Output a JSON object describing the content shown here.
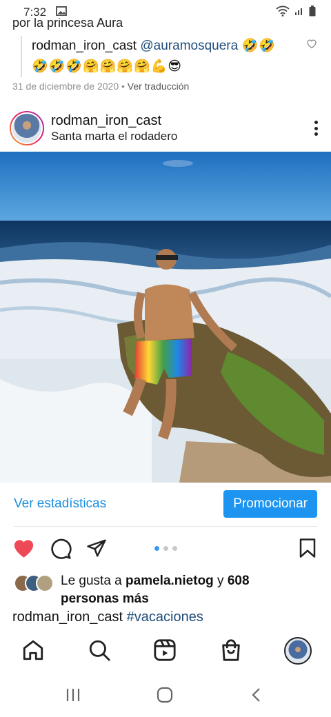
{
  "status_bar": {
    "time": "7:32"
  },
  "previous_comment": {
    "cut_text": "por la princesa Aura",
    "reply_user": "rodman_iron_cast",
    "reply_mention": "@auramosquera",
    "reply_emojis_line1": "🤣🤣",
    "reply_emojis_line2": "🤣🤣🤣🤗🤗🤗🤗💪😎",
    "date": "31 de diciembre de 2020",
    "separator": "•",
    "translate": "Ver traducción"
  },
  "post": {
    "username": "rodman_iron_cast",
    "location": "Santa marta el rodadero",
    "insights_label": "Ver estadísticas",
    "promote_label": "Promocionar",
    "carousel": {
      "count": 3,
      "active": 0
    },
    "likes": {
      "prefix": "Le gusta a ",
      "user": "pamela.nietog",
      "joiner": " y ",
      "count": "608",
      "suffix": "personas más"
    },
    "caption_user": "rodman_iron_cast",
    "caption_hashtag": "#vacaciones"
  },
  "icons": {
    "status": [
      "gallery-icon",
      "wifi-icon",
      "signal-icon",
      "battery-icon"
    ],
    "actions": [
      "heart-filled-icon",
      "comment-icon",
      "share-icon",
      "bookmark-icon"
    ],
    "tabs": [
      "home-icon",
      "search-icon",
      "reels-icon",
      "shop-icon",
      "profile-avatar"
    ],
    "system_nav": [
      "recents-icon",
      "home-circle-icon",
      "back-icon"
    ]
  },
  "colors": {
    "link_blue": "#1a8fe0",
    "promote_bg": "#1d95f0",
    "like_red": "#ed4956",
    "hashtag": "#1f4d7a"
  }
}
